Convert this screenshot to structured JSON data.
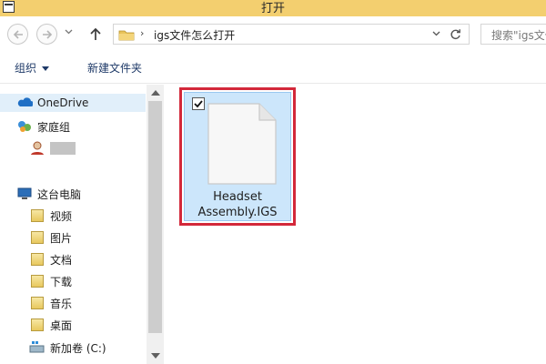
{
  "window": {
    "title": "打开"
  },
  "address": {
    "path": "igs文件怎么打开",
    "separator": "›",
    "search_placeholder": "搜索\"igs文件..."
  },
  "toolbar": {
    "organize_label": "组织",
    "new_folder_label": "新建文件夹"
  },
  "sidebar": {
    "onedrive": "OneDrive",
    "homegroup": "家庭组",
    "this_pc": "这台电脑",
    "items": [
      {
        "label": "视频",
        "icon": "videos-folder-icon"
      },
      {
        "label": "图片",
        "icon": "pictures-folder-icon"
      },
      {
        "label": "文档",
        "icon": "documents-folder-icon"
      },
      {
        "label": "下载",
        "icon": "downloads-folder-icon"
      },
      {
        "label": "音乐",
        "icon": "music-folder-icon"
      },
      {
        "label": "桌面",
        "icon": "desktop-folder-icon"
      },
      {
        "label": "新加卷 (C:)",
        "icon": "drive-icon"
      }
    ]
  },
  "files": [
    {
      "name_line1": "Headset",
      "name_line2": "Assembly.IGS",
      "selected": true,
      "checked": true
    }
  ],
  "colors": {
    "titlebar": "#f3cf6f",
    "selection_fill": "#cce6fb",
    "highlight_border": "#d3283a"
  }
}
